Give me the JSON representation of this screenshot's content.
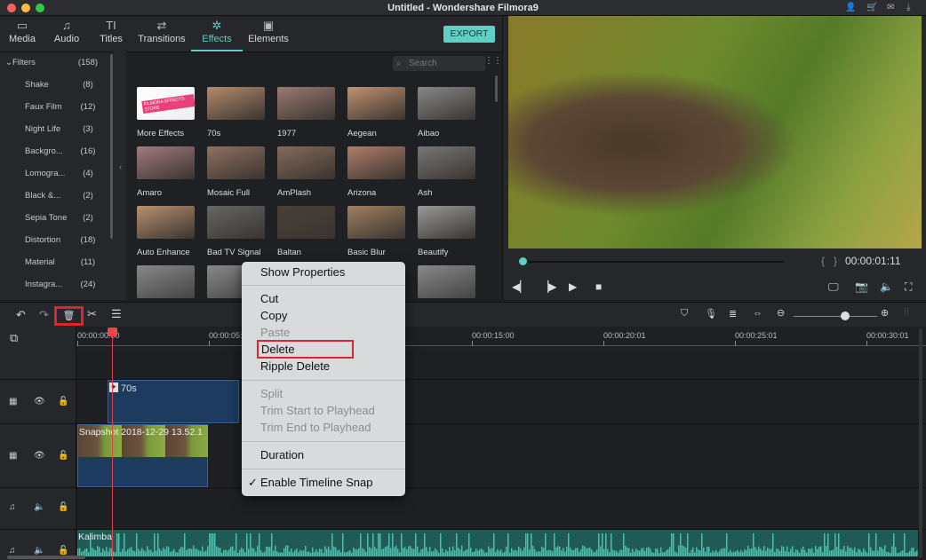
{
  "window": {
    "title": "Untitled - Wondershare Filmora9",
    "traffic": [
      "#fc605c",
      "#fdbc40",
      "#34c84a"
    ]
  },
  "tabs": [
    {
      "label": "Media",
      "icon": "folder-icon"
    },
    {
      "label": "Audio",
      "icon": "music-note-icon"
    },
    {
      "label": "Titles",
      "icon": "text-icon"
    },
    {
      "label": "Transitions",
      "icon": "transitions-icon"
    },
    {
      "label": "Effects",
      "icon": "effects-icon",
      "active": true
    },
    {
      "label": "Elements",
      "icon": "image-icon"
    }
  ],
  "export_label": "EXPORT",
  "search_placeholder": "Search",
  "sidebar": {
    "header": {
      "label": "Filters",
      "count": "(158)"
    },
    "items": [
      {
        "label": "Shake",
        "count": "(8)"
      },
      {
        "label": "Faux Film",
        "count": "(12)"
      },
      {
        "label": "Night Life",
        "count": "(3)"
      },
      {
        "label": "Backgro...",
        "count": "(16)"
      },
      {
        "label": "Lomogra...",
        "count": "(4)"
      },
      {
        "label": "Black &...",
        "count": "(2)"
      },
      {
        "label": "Sepia Tone",
        "count": "(2)"
      },
      {
        "label": "Distortion",
        "count": "(18)"
      },
      {
        "label": "Material",
        "count": "(11)"
      },
      {
        "label": "Instagra...",
        "count": "(24)"
      }
    ]
  },
  "effects": [
    {
      "label": "More Effects",
      "badge": "FILMORA EFFECTS STORE"
    },
    {
      "label": "70s"
    },
    {
      "label": "1977"
    },
    {
      "label": "Aegean"
    },
    {
      "label": "Aibao"
    },
    {
      "label": "Amaro"
    },
    {
      "label": "Mosaic Full"
    },
    {
      "label": "AmPlash"
    },
    {
      "label": "Arizona"
    },
    {
      "label": "Ash"
    },
    {
      "label": "Auto Enhance"
    },
    {
      "label": "Bad TV Signal"
    },
    {
      "label": "Baltan"
    },
    {
      "label": "Basic Blur"
    },
    {
      "label": "Beautify"
    }
  ],
  "preview": {
    "timecode": "00:00:01:11",
    "progress": 0.0
  },
  "ruler": [
    "00:00:00:00",
    "00:00:05:00",
    "00:00:10:00",
    "00:00:15:00",
    "00:00:20:01",
    "00:00:25:01",
    "00:00:30:01"
  ],
  "clips": {
    "effect": "70s",
    "video": "Snapshot 2018-12-29 13.52.1",
    "audio": "Kalimba"
  },
  "context_menu": {
    "items": [
      "Show Properties",
      "Cut",
      "Copy",
      "Paste",
      "Delete",
      "Ripple Delete",
      "Split",
      "Trim Start to Playhead",
      "Trim End to Playhead",
      "Duration",
      "Enable Timeline Snap"
    ],
    "check": "✓"
  },
  "accent": "#5fd1c4",
  "highlight": "#e0242e"
}
